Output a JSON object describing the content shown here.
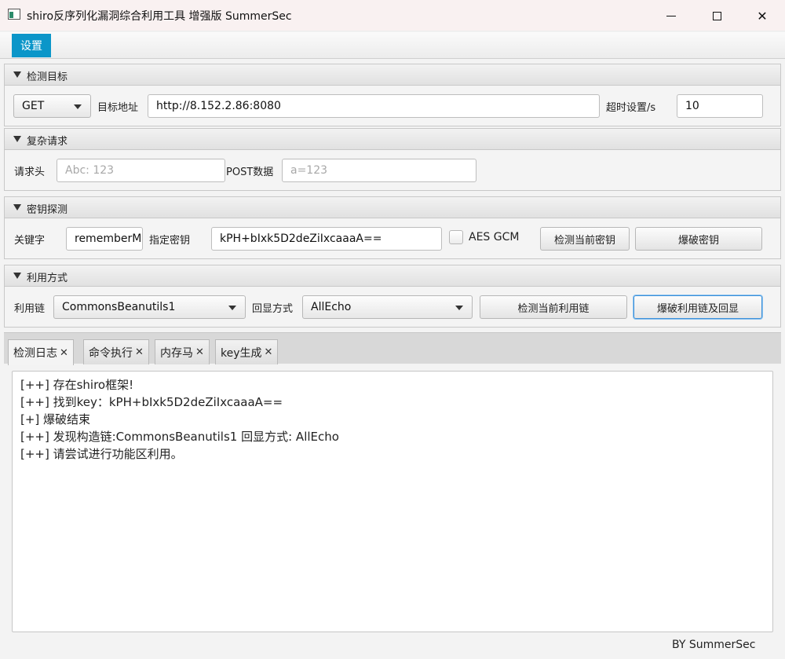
{
  "window": {
    "title": "shiro反序列化漏洞综合利用工具 增强版 SummerSec",
    "close_glyph": "✕"
  },
  "menu": {
    "settings": "设置"
  },
  "target": {
    "header": "检测目标",
    "method": "GET",
    "url_label": "目标地址",
    "url_value": "http://8.152.2.86:8080",
    "timeout_label": "超时设置/s",
    "timeout_value": "10"
  },
  "complex": {
    "header": "复杂请求",
    "headers_label": "请求头",
    "headers_placeholder": "Abc: 123",
    "post_label": "POST数据",
    "post_placeholder": "a=123"
  },
  "key": {
    "header": "密钥探测",
    "keyword_label": "关键字",
    "keyword_value": "rememberMe",
    "specify_label": "指定密钥",
    "specify_value": "kPH+bIxk5D2deZiIxcaaaA==",
    "aes_gcm_label": "AES GCM",
    "check_key_button": "检测当前密钥",
    "brute_key_button": "爆破密钥"
  },
  "exploit": {
    "header": "利用方式",
    "chain_label": "利用链",
    "chain_value": "CommonsBeanutils1",
    "echo_label": "回显方式",
    "echo_value": "AllEcho",
    "check_chain_button": "检测当前利用链",
    "brute_chain_button": "爆破利用链及回显"
  },
  "tabs": [
    {
      "label": "检测日志",
      "close": "✕"
    },
    {
      "label": "命令执行",
      "close": "✕"
    },
    {
      "label": "内存马",
      "close": "✕"
    },
    {
      "label": "key生成",
      "close": "✕"
    }
  ],
  "log": [
    "[++] 存在shiro框架!",
    "[++] 找到key：kPH+bIxk5D2deZiIxcaaaA==",
    "[+] 爆破结束",
    "[++] 发现构造链:CommonsBeanutils1  回显方式: AllEcho",
    "[++] 请尝试进行功能区利用。"
  ],
  "footer": "BY   SummerSec"
}
